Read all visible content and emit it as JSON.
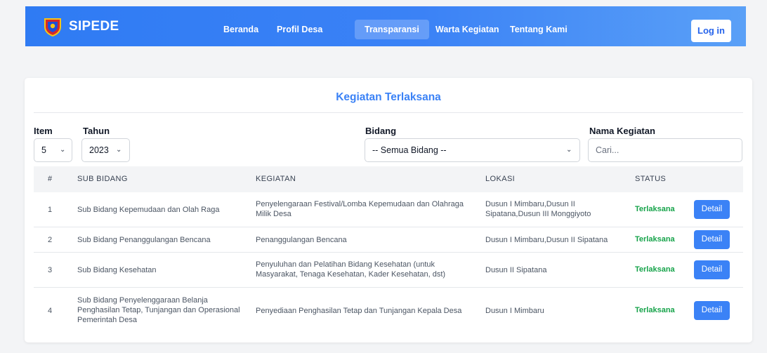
{
  "navbar": {
    "brand": "SIPEDE",
    "links": [
      "Beranda",
      "Profil Desa",
      "Transparansi",
      "Warta Kegiatan",
      "Tentang Kami"
    ],
    "active_link": "Transparansi",
    "login_label": "Log in"
  },
  "card": {
    "title": "Kegiatan Terlaksana",
    "filters": {
      "item_label": "Item",
      "item_value": "5",
      "tahun_label": "Tahun",
      "tahun_value": "2023",
      "bidang_label": "Bidang",
      "bidang_value": "-- Semua Bidang --",
      "nama_label": "Nama Kegiatan",
      "nama_placeholder": "Cari..."
    },
    "table": {
      "headers": [
        "#",
        "SUB BIDANG",
        "KEGIATAN",
        "LOKASI",
        "STATUS"
      ],
      "rows": [
        {
          "no": "1",
          "sub_bidang": "Sub Bidang Kepemudaan dan Olah Raga",
          "kegiatan": "Penyelengaraan Festival/Lomba Kepemudaan dan Olahraga Milik Desa",
          "lokasi": "Dusun I Mimbaru,Dusun II Sipatana,Dusun III Monggiyoto",
          "status": "Terlaksana",
          "action": "Detail"
        },
        {
          "no": "2",
          "sub_bidang": "Sub Bidang Penanggulangan Bencana",
          "kegiatan": "Penanggulangan Bencana",
          "lokasi": "Dusun I Mimbaru,Dusun II Sipatana",
          "status": "Terlaksana",
          "action": "Detail"
        },
        {
          "no": "3",
          "sub_bidang": "Sub Bidang Kesehatan",
          "kegiatan": "Penyuluhan dan Pelatihan Bidang Kesehatan (untuk Masyarakat, Tenaga Kesehatan, Kader Kesehatan, dst)",
          "lokasi": "Dusun II Sipatana",
          "status": "Terlaksana",
          "action": "Detail"
        },
        {
          "no": "4",
          "sub_bidang": "Sub Bidang Penyelenggaraan Belanja Penghasilan Tetap, Tunjangan dan Operasional Pemerintah Desa",
          "kegiatan": "Penyediaan Penghasilan Tetap dan Tunjangan Kepala Desa",
          "lokasi": "Dusun I Mimbaru",
          "status": "Terlaksana",
          "action": "Detail"
        }
      ]
    }
  },
  "colors": {
    "primary": "#3b82f6",
    "status_green": "#16a34a"
  }
}
